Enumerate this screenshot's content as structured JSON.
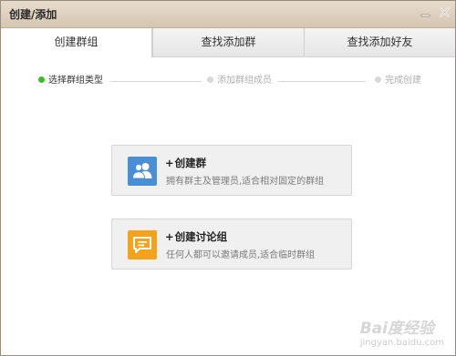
{
  "window": {
    "title": "创建/添加"
  },
  "tabs": [
    {
      "label": "创建群组",
      "active": true
    },
    {
      "label": "查找添加群",
      "active": false
    },
    {
      "label": "查找添加好友",
      "active": false
    }
  ],
  "steps": [
    {
      "label": "选择群组类型",
      "active": true
    },
    {
      "label": "添加群组成员",
      "active": false
    },
    {
      "label": "完成创建",
      "active": false
    }
  ],
  "options": [
    {
      "title": "创建群",
      "prefix": "+",
      "description": "拥有群主及管理员,适合相对固定的群组",
      "icon": "group-people-icon",
      "icon_color": "#4a8fd6"
    },
    {
      "title": "创建讨论组",
      "prefix": "+",
      "description": "任何人都可以邀请成员,适合临时群组",
      "icon": "chat-bubble-icon",
      "icon_color": "#f5a21c"
    }
  ],
  "watermark": {
    "text": "Bai度经验",
    "sub": "jingyan.baidu.com"
  },
  "colors": {
    "step_active": "#3cbb2b",
    "titlebar": "#dccfbe"
  }
}
